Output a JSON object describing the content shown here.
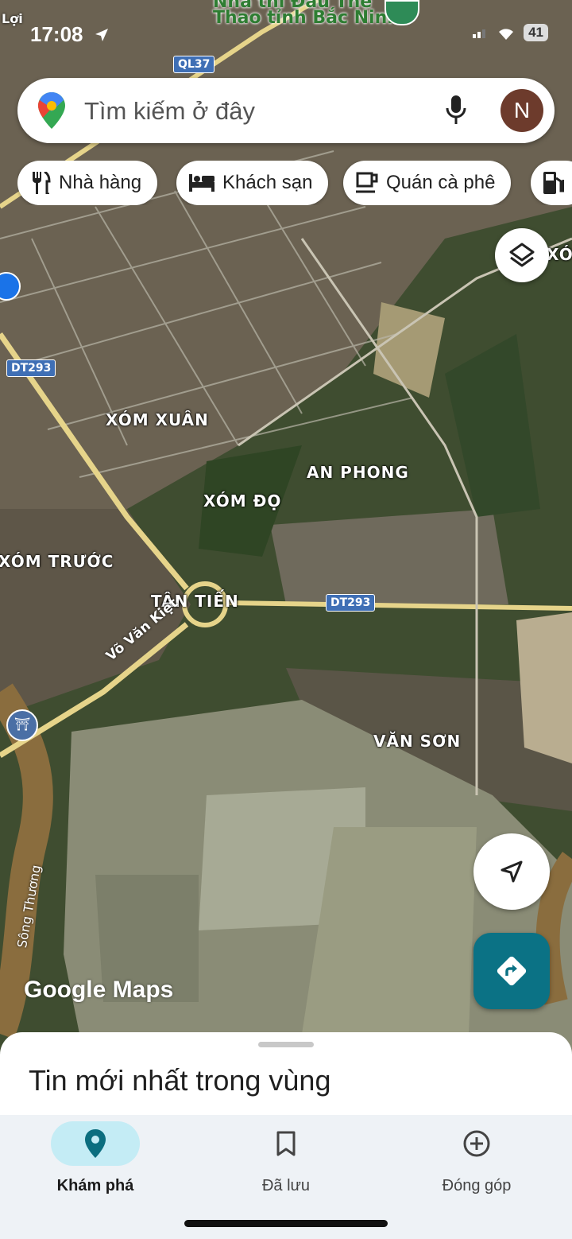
{
  "status_bar": {
    "time": "17:08",
    "battery": "41"
  },
  "search": {
    "placeholder": "Tìm kiếm ở đây",
    "avatar_letter": "N"
  },
  "chips": [
    {
      "label": "Nhà hàng",
      "icon": "restaurant-icon"
    },
    {
      "label": "Khách sạn",
      "icon": "hotel-icon"
    },
    {
      "label": "Quán cà phê",
      "icon": "coffee-icon"
    },
    {
      "label": "",
      "icon": "gas-station-icon"
    }
  ],
  "map": {
    "top_labels": {
      "line1": "Nhà thi Đấu Thể",
      "line2": "Thao tỉnh Bắc Ninh",
      "corner": "Lợi"
    },
    "places": [
      "XÓM XUÂN",
      "AN PHONG",
      "XÓM ĐỌ",
      "XÓM TRƯỚC",
      "TÂN TIẾN",
      "VĂN SƠN",
      "XÓM"
    ],
    "roads": {
      "shield_ql37": "QL37",
      "shield_dt293_left": "DT293",
      "shield_dt293_center": "DT293",
      "street_name": "Võ Văn Kiệt",
      "river_name": "Sông Thương"
    },
    "watermark": "Google Maps"
  },
  "bottom_sheet": {
    "title": "Tin mới nhất trong vùng"
  },
  "nav": [
    {
      "label": "Khám phá",
      "icon": "explore-pin-icon",
      "active": true
    },
    {
      "label": "Đã lưu",
      "icon": "bookmark-icon",
      "active": false
    },
    {
      "label": "Đóng góp",
      "icon": "add-circle-icon",
      "active": false
    }
  ]
}
